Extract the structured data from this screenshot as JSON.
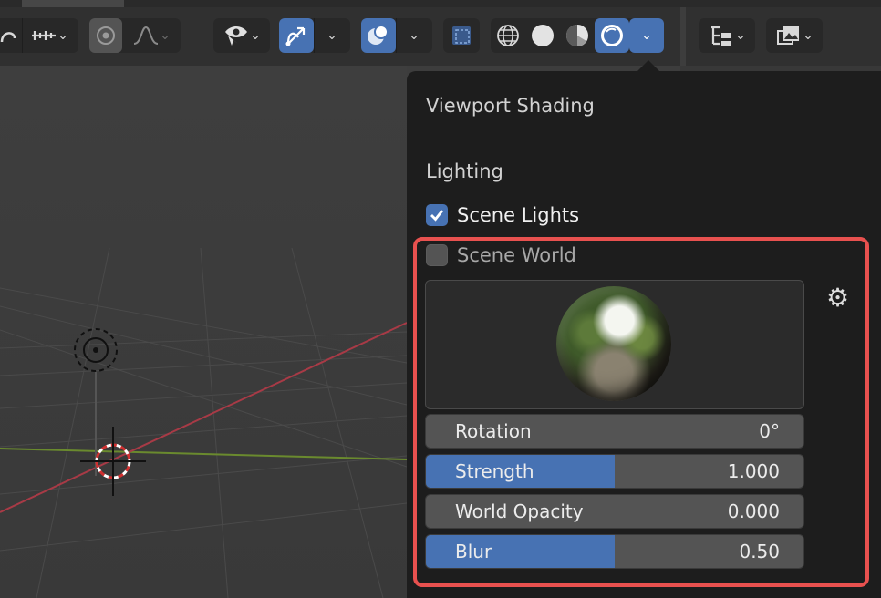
{
  "popover": {
    "title": "Viewport Shading",
    "section": "Lighting",
    "scene_lights": {
      "label": "Scene Lights",
      "checked": true
    },
    "scene_world": {
      "label": "Scene World",
      "checked": false
    },
    "sliders": [
      {
        "label": "Rotation",
        "value": "0°",
        "fill": 0
      },
      {
        "label": "Strength",
        "value": "1.000",
        "fill": 0.5
      },
      {
        "label": "World Opacity",
        "value": "0.000",
        "fill": 0
      },
      {
        "label": "Blur",
        "value": "0.50",
        "fill": 0.5
      }
    ]
  },
  "toolbar": {
    "icons": [
      "snapping-icon",
      "snap-increment-icon",
      "proportional-edit-icon",
      "falloff-curve-icon",
      "visibility-eye-icon",
      "gizmo-icon",
      "overlays-icon",
      "xray-icon",
      "wireframe-shading-icon",
      "solid-shading-icon",
      "material-preview-icon",
      "rendered-shading-icon",
      "outliner-filter-icon",
      "image-display-icon"
    ]
  },
  "colors": {
    "accent": "#4772b3",
    "highlight": "#e8514f",
    "popover_bg": "#1d1d1d"
  }
}
